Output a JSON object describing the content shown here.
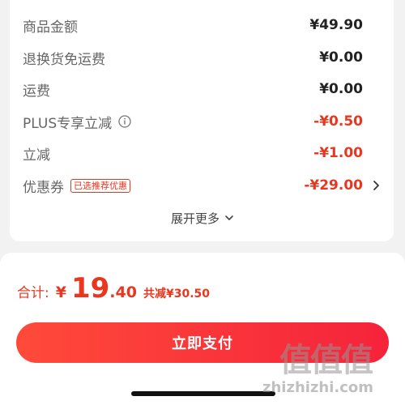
{
  "summary": {
    "rows": [
      {
        "label": "商品金额",
        "value": "¥49.90"
      },
      {
        "label": "退换货免运费",
        "value": "¥0.00"
      },
      {
        "label": "运费",
        "value": "¥0.00"
      },
      {
        "label": "PLUS专享立减",
        "value": "-¥0.50",
        "icon": "info-icon"
      },
      {
        "label": "立减",
        "value": "-¥1.00"
      },
      {
        "label": "优惠券",
        "value": "-¥29.00",
        "tag": "已选推荐优惠"
      }
    ],
    "expand_label": "展开更多"
  },
  "checkout": {
    "total_label": "合计:",
    "currency": "¥",
    "amount_int": "19",
    "amount_dec": ".40",
    "saved_label": "共减¥30.50",
    "pay_label": "立即支付"
  },
  "watermark": {
    "mark": "值值值",
    "url": "zhizhizhi.com"
  },
  "colors": {
    "accent": "#e8361f",
    "button": "#f5233b",
    "background": "#f2f2f2"
  }
}
